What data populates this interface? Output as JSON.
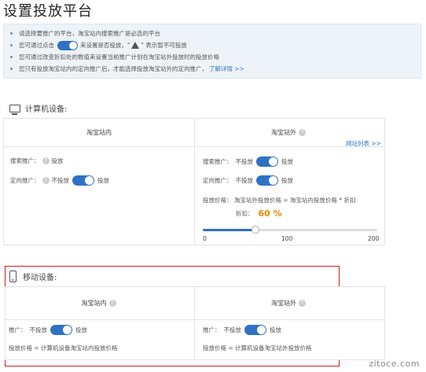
{
  "page": {
    "title": "设置投放平台"
  },
  "notices": {
    "line1": "请选择要推广的平台，淘宝站内搜索推广是必选的平台",
    "line2_pre": "您可通过点击",
    "line2_mid": "来设置是否投放，\"",
    "line2_post": "\" 表示暂不可投放",
    "line3": "您可通过改变折扣处的数值来设置当前推广计划在淘宝站外投放时的投放价格",
    "line4_pre": "您只有投放淘宝站内的定向推广后，才能选择投放淘宝站外的定向推广，",
    "learn_more": "了解详情 >>"
  },
  "pc": {
    "heading": "计算机设备:",
    "inside": {
      "title": "淘宝站内",
      "search_label": "搜索推广：",
      "search_value": "投放",
      "target_label": "定向推广：",
      "target_off": "不投放",
      "target_on": "投放"
    },
    "outside": {
      "title": "淘宝站外",
      "site_list": "网站列表 >>",
      "search_label": "搜索推广：",
      "search_off": "不投放",
      "search_on": "投放",
      "target_label": "定向推广：",
      "target_off": "不投放",
      "target_on": "投放",
      "price_text": "投放价格：  淘宝站外投放价格 = 淘宝站内投放价格 * 折扣",
      "discount_label": "折扣：",
      "discount_value": "60 %",
      "discount_fraction": 0.6,
      "slider_min": "0",
      "slider_mid": "100",
      "slider_max": "200"
    }
  },
  "mobile": {
    "heading": "移动设备:",
    "inside": {
      "title": "淘宝站内",
      "promo_label": "推广：",
      "off": "不投放",
      "on": "投放",
      "price_text": "投放价格 =  计算机设备淘宝站内投放价格"
    },
    "outside": {
      "title": "淘宝站外",
      "promo_label": "推广：",
      "off": "不投放",
      "on": "投放",
      "price_text": "投放价格 =  计算机设备淘宝站外投放价格"
    }
  },
  "watermark": "zitoce.com",
  "colors": {
    "toggle": "#2f72c4",
    "link": "#2b78c5",
    "discount": "#e68a00",
    "highlight_box": "#d41e1e"
  }
}
